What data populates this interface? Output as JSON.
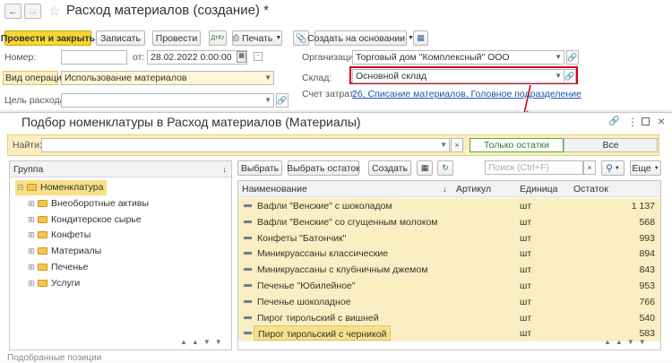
{
  "window": {
    "title": "Расход материалов (создание) *"
  },
  "toolbar": {
    "post_close": "Провести и закрыть",
    "save": "Записать",
    "post": "Провести",
    "print": "Печать",
    "create_based": "Создать на основании"
  },
  "form": {
    "number_label": "Номер:",
    "number_value": "",
    "from_label": "от:",
    "date_value": "28.02.2022  0:00:00",
    "org_label": "Организация:",
    "org_value": "Торговый дом \"Комплексный\" ООО",
    "optype_label": "Вид операции:",
    "optype_value": "Использование материалов",
    "warehouse_label": "Склад:",
    "warehouse_value": "Основной склад",
    "purpose_label": "Цель расхода:",
    "purpose_value": "",
    "cost_label": "Счет затрат:",
    "cost_value": "26, Списание материалов, Головное подразделение"
  },
  "dialog": {
    "title": "Подбор номенклатуры в Расход материалов (Материалы)",
    "find_label": "Найти:",
    "find_value": "",
    "only_balances": "Только остатки",
    "all": "Все",
    "group_header": "Группа",
    "select": "Выбрать",
    "select_balance": "Выбрать остаток",
    "create": "Создать",
    "search_placeholder": "Поиск (Ctrl+F)",
    "more": "Еще",
    "footer_label": "Подобранные позиции",
    "tree": [
      {
        "label": "Номенклатура",
        "root": true
      },
      {
        "label": "Внеоборотные активы"
      },
      {
        "label": "Кондитерское сырье"
      },
      {
        "label": "Конфеты"
      },
      {
        "label": "Материалы"
      },
      {
        "label": "Печенье"
      },
      {
        "label": "Услуги"
      }
    ],
    "columns": {
      "name": "Наименование",
      "article": "Артикул",
      "unit": "Единица",
      "balance": "Остаток"
    },
    "rows": [
      {
        "name": "Вафли \"Венские\" с шоколадом",
        "article": "",
        "unit": "шт",
        "balance": "1 137"
      },
      {
        "name": "Вафли \"Венские\" со сгущенным молоком",
        "article": "",
        "unit": "шт",
        "balance": "568"
      },
      {
        "name": "Конфеты \"Батончик\"",
        "article": "",
        "unit": "шт",
        "balance": "993"
      },
      {
        "name": "Миникруассаны классические",
        "article": "",
        "unit": "шт",
        "balance": "894"
      },
      {
        "name": "Миникруассаны с клубничным джемом",
        "article": "",
        "unit": "шт",
        "balance": "843"
      },
      {
        "name": "Печенье \"Юбилейное\"",
        "article": "",
        "unit": "шт",
        "balance": "953"
      },
      {
        "name": "Печенье шоколадное",
        "article": "",
        "unit": "шт",
        "balance": "766"
      },
      {
        "name": "Пирог тирольский с вишней",
        "article": "",
        "unit": "шт",
        "balance": "540"
      },
      {
        "name": "Пирог тирольский с черникой",
        "article": "",
        "unit": "шт",
        "balance": "583"
      }
    ]
  },
  "colors": {
    "primary": "#f7d631",
    "highlight": "#fbeec0",
    "selected": "#f8e08a",
    "annotation": "#d0021b",
    "link": "#1a56a8"
  }
}
